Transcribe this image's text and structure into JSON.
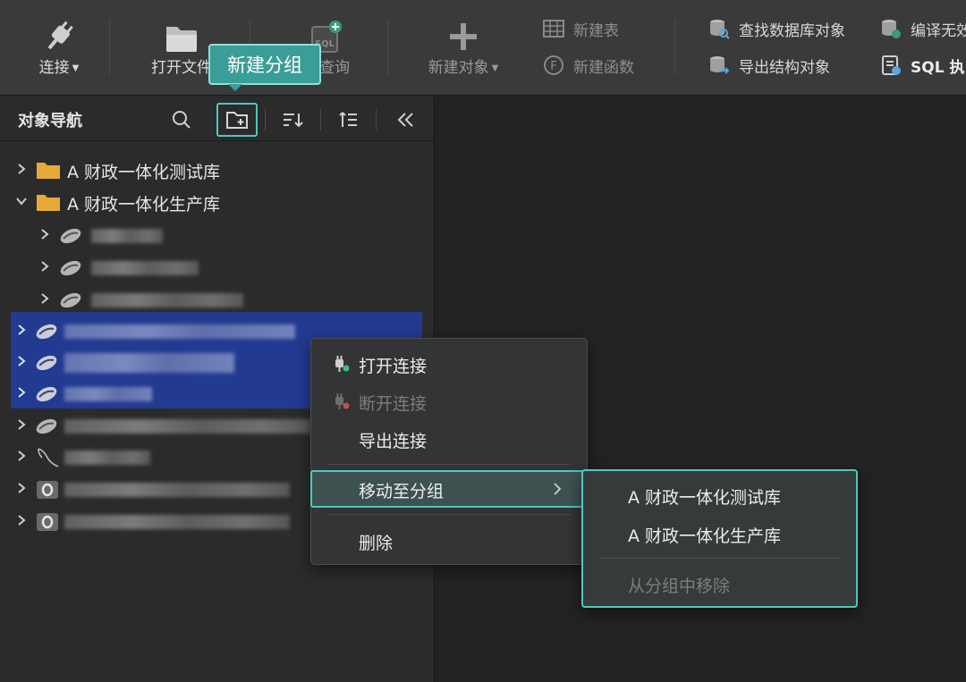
{
  "toolbar": {
    "connect_label": "连接",
    "open_file_label": "打开文件",
    "new_query_label": "查询",
    "new_object_label": "新建对象",
    "new_table_label": "新建表",
    "new_function_label": "新建函数",
    "find_db_object_label": "查找数据库对象",
    "export_structure_label": "导出结构对象",
    "compile_invalid_label": "编译无效",
    "sql_exec_label": "SQL 执"
  },
  "tooltip": {
    "text": "新建分组"
  },
  "navigator": {
    "title": "对象导航",
    "groups": [
      {
        "label": "A 财政一体化测试库",
        "expanded": false
      },
      {
        "label": "A 财政一体化生产库",
        "expanded": true
      }
    ]
  },
  "context_menu": {
    "items": [
      {
        "label": "打开连接",
        "enabled": true
      },
      {
        "label": "断开连接",
        "enabled": false
      },
      {
        "label": "导出连接",
        "enabled": true
      },
      {
        "label": "移动至分组",
        "enabled": true,
        "highlighted": true
      },
      {
        "label": "删除",
        "enabled": true
      }
    ]
  },
  "submenu": {
    "items": [
      {
        "label": "A 财政一体化测试库",
        "enabled": true
      },
      {
        "label": "A 财政一体化生产库",
        "enabled": true
      },
      {
        "label": "从分组中移除",
        "enabled": false
      }
    ]
  },
  "colors": {
    "accent": "#4fc7bd",
    "tooltip_bg": "#3a9d97",
    "selection": "#233a91",
    "folder": "#e6a93a"
  }
}
